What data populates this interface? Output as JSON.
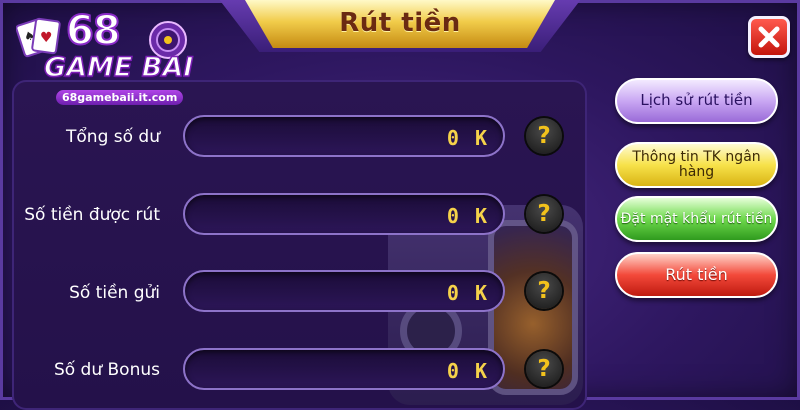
{
  "title": "Rút tiền",
  "logo": {
    "number": "68",
    "word": "GAME BAI",
    "url": "68gamebaii.it.com"
  },
  "rows": [
    {
      "label": "Tổng số dư",
      "value": "0 K"
    },
    {
      "label": "Số tiền được rút",
      "value": "0 K"
    },
    {
      "label": "Số tiền gửi",
      "value": "0 K"
    },
    {
      "label": "Số dư Bonus",
      "value": "0 K"
    }
  ],
  "help_label": "?",
  "side_buttons": {
    "history": "Lịch sử rút tiền",
    "bank_info": "Thông tin TK ngân hàng",
    "set_password": "Đặt mật khẩu rút tiền",
    "withdraw": "Rút tiền"
  },
  "icons": {
    "close": "close-icon",
    "help": "help-icon"
  },
  "colors": {
    "background": "#2e1760",
    "title_gold": "#f1cc4a",
    "value_gold": "#f5d24a",
    "close_red": "#e0281e"
  }
}
